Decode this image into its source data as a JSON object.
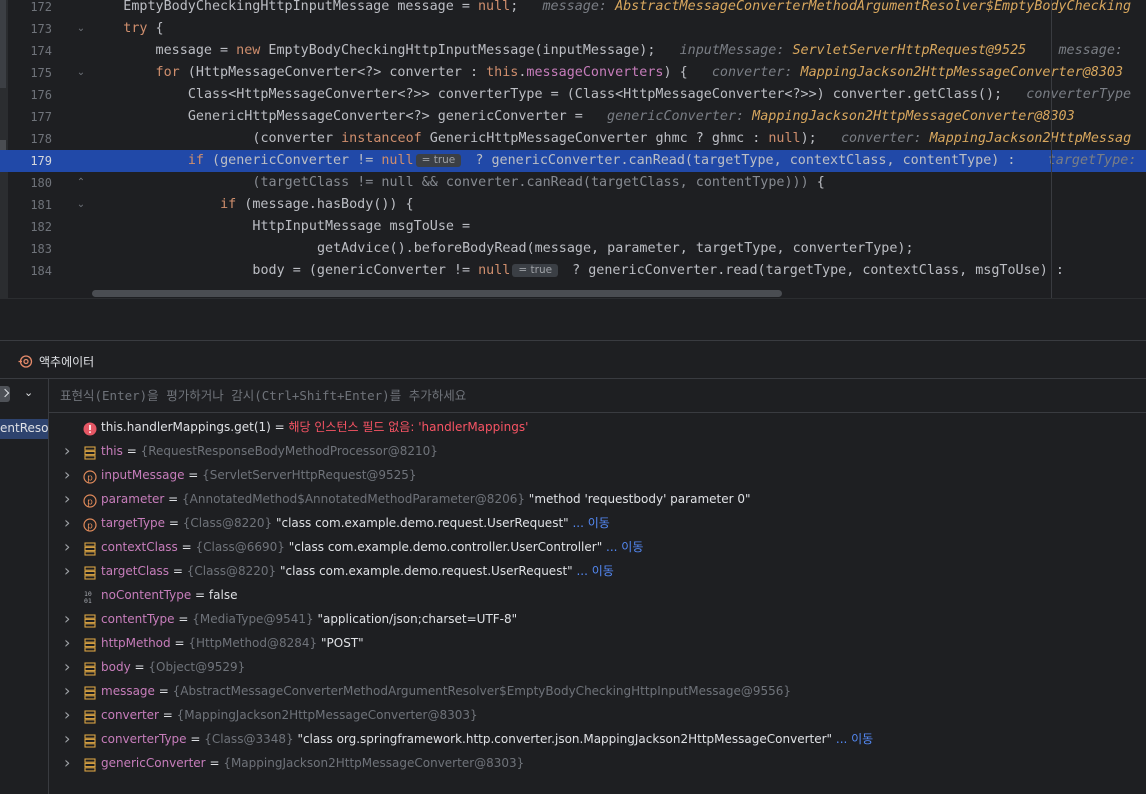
{
  "editor": {
    "lines": [
      {
        "n": "172",
        "fold": "",
        "hl": false,
        "indent": 4,
        "segs": [
          [
            "t",
            "EmptyBodyCheckingHttpInputMessage message = "
          ],
          [
            "kw",
            "null"
          ],
          [
            "t",
            ";"
          ]
        ],
        "hint": [
          [
            "n",
            "message: "
          ],
          [
            "v",
            "AbstractMessageConverterMethodArgumentResolver$EmptyBodyChecking"
          ]
        ]
      },
      {
        "n": "173",
        "fold": "⌄",
        "hl": false,
        "indent": 4,
        "segs": [
          [
            "kw",
            "try"
          ],
          [
            "t",
            " {"
          ]
        ],
        "hint": []
      },
      {
        "n": "174",
        "fold": "",
        "hl": false,
        "indent": 8,
        "segs": [
          [
            "t",
            "message = "
          ],
          [
            "kw",
            "new"
          ],
          [
            "t",
            " EmptyBodyCheckingHttpInputMessage(inputMessage);"
          ]
        ],
        "hint": [
          [
            "n",
            "inputMessage: "
          ],
          [
            "v",
            "ServletServerHttpRequest@9525"
          ],
          [
            "n",
            "    message: "
          ]
        ]
      },
      {
        "n": "175",
        "fold": "⌄",
        "hl": false,
        "indent": 8,
        "segs": [
          [
            "kw",
            "for"
          ],
          [
            "t",
            " (HttpMessageConverter<?> converter : "
          ],
          [
            "kw",
            "this"
          ],
          [
            "t",
            "."
          ],
          [
            "fld",
            "messageConverters"
          ],
          [
            "t",
            ") {"
          ]
        ],
        "hint": [
          [
            "n",
            "converter: "
          ],
          [
            "v",
            "MappingJackson2HttpMessageConverter@8303"
          ]
        ]
      },
      {
        "n": "176",
        "fold": "",
        "hl": false,
        "indent": 12,
        "segs": [
          [
            "t",
            "Class<HttpMessageConverter<?>> converterType = (Class<HttpMessageConverter<?>>) converter.getClass();"
          ]
        ],
        "hint": [
          [
            "n",
            "converterType"
          ]
        ]
      },
      {
        "n": "177",
        "fold": "",
        "hl": false,
        "indent": 12,
        "segs": [
          [
            "t",
            "GenericHttpMessageConverter<?> genericConverter ="
          ]
        ],
        "hint": [
          [
            "n",
            "genericConverter: "
          ],
          [
            "v",
            "MappingJackson2HttpMessageConverter@8303"
          ]
        ]
      },
      {
        "n": "178",
        "fold": "",
        "hl": false,
        "indent": 20,
        "segs": [
          [
            "t",
            "(converter "
          ],
          [
            "kw",
            "instanceof"
          ],
          [
            "t",
            " GenericHttpMessageConverter ghmc ? ghmc : "
          ],
          [
            "kw",
            "null"
          ],
          [
            "t",
            ");"
          ]
        ],
        "hint": [
          [
            "n",
            "converter: "
          ],
          [
            "v",
            "MappingJackson2HttpMessag"
          ]
        ]
      },
      {
        "n": "179",
        "fold": "",
        "hl": true,
        "indent": 12,
        "segs": [
          [
            "kw",
            "if"
          ],
          [
            "t",
            " (genericConverter != "
          ],
          [
            "kw",
            "null"
          ],
          [
            "chip",
            "= true"
          ],
          [
            "t",
            " ? genericConverter.canRead(targetType, contextClass, contentType) : "
          ]
        ],
        "hint": [
          [
            "n",
            "targetType: "
          ]
        ]
      },
      {
        "n": "180",
        "fold": "⌃",
        "hl": false,
        "indent": 20,
        "segs": [
          [
            "gry",
            "(targetClass != null && converter.canRead(targetClass, contentType)))"
          ],
          [
            "t",
            " {"
          ]
        ],
        "hint": []
      },
      {
        "n": "181",
        "fold": "⌄",
        "hl": false,
        "indent": 16,
        "segs": [
          [
            "kw",
            "if"
          ],
          [
            "t",
            " (message.hasBody()) {"
          ]
        ],
        "hint": []
      },
      {
        "n": "182",
        "fold": "",
        "hl": false,
        "indent": 20,
        "segs": [
          [
            "t",
            "HttpInputMessage msgToUse ="
          ]
        ],
        "hint": []
      },
      {
        "n": "183",
        "fold": "",
        "hl": false,
        "indent": 28,
        "segs": [
          [
            "t",
            "getAdvice().beforeBodyRead(message, parameter, targetType, converterType);"
          ]
        ],
        "hint": []
      },
      {
        "n": "184",
        "fold": "",
        "hl": false,
        "indent": 20,
        "segs": [
          [
            "t",
            "body = (genericConverter != "
          ],
          [
            "kw",
            "null"
          ],
          [
            "chip",
            "= true"
          ],
          [
            "t",
            " ? genericConverter.read(targetType, contextClass, msgToUse) :"
          ]
        ],
        "hint": []
      }
    ]
  },
  "debugger": {
    "tab_label": "액추에이터",
    "frame_label": "entResolv",
    "expr_placeholder": "표현식(Enter)을 평가하거나 감시(Ctrl+Shift+Enter)를 추가하세요",
    "variables": [
      {
        "icon": "error",
        "expand": false,
        "name": "this.handlerMappings.get(1)",
        "eq": " = ",
        "ref": "",
        "value": "해당 인스턴스 필드 없음: 'handlerMappings'",
        "link": "",
        "style": "error"
      },
      {
        "icon": "field",
        "expand": true,
        "name": "this",
        "eq": " = ",
        "ref": "{RequestResponseBodyMethodProcessor@8210}",
        "value": "",
        "link": "",
        "style": "field"
      },
      {
        "icon": "param",
        "expand": true,
        "name": "inputMessage",
        "eq": " = ",
        "ref": "{ServletServerHttpRequest@9525}",
        "value": "",
        "link": "",
        "style": "field"
      },
      {
        "icon": "param",
        "expand": true,
        "name": "parameter",
        "eq": " = ",
        "ref": "{AnnotatedMethod$AnnotatedMethodParameter@8206}",
        "value": " \"method 'requestbody' parameter 0\"",
        "link": "",
        "style": "field"
      },
      {
        "icon": "param",
        "expand": true,
        "name": "targetType",
        "eq": " = ",
        "ref": "{Class@8220}",
        "value": " \"class com.example.demo.request.UserRequest\"",
        "link": " ... 이동",
        "style": "field"
      },
      {
        "icon": "field",
        "expand": true,
        "name": "contextClass",
        "eq": " = ",
        "ref": "{Class@6690}",
        "value": " \"class com.example.demo.controller.UserController\"",
        "link": " ... 이동",
        "style": "field"
      },
      {
        "icon": "field",
        "expand": true,
        "name": "targetClass",
        "eq": " = ",
        "ref": "{Class@8220}",
        "value": " \"class com.example.demo.request.UserRequest\"",
        "link": " ... 이동",
        "style": "field"
      },
      {
        "icon": "prim",
        "expand": false,
        "name": "noContentType",
        "eq": " = ",
        "ref": "",
        "value": "false",
        "link": "",
        "style": "plain"
      },
      {
        "icon": "field",
        "expand": true,
        "name": "contentType",
        "eq": " = ",
        "ref": "{MediaType@9541}",
        "value": " \"application/json;charset=UTF-8\"",
        "link": "",
        "style": "field"
      },
      {
        "icon": "field",
        "expand": true,
        "name": "httpMethod",
        "eq": " = ",
        "ref": "{HttpMethod@8284}",
        "value": " \"POST\"",
        "link": "",
        "style": "field"
      },
      {
        "icon": "field",
        "expand": true,
        "name": "body",
        "eq": " = ",
        "ref": "{Object@9529}",
        "value": "",
        "link": "",
        "style": "field"
      },
      {
        "icon": "field",
        "expand": true,
        "name": "message",
        "eq": " = ",
        "ref": "{AbstractMessageConverterMethodArgumentResolver$EmptyBodyCheckingHttpInputMessage@9556}",
        "value": "",
        "link": "",
        "style": "field"
      },
      {
        "icon": "field",
        "expand": true,
        "name": "converter",
        "eq": " = ",
        "ref": "{MappingJackson2HttpMessageConverter@8303}",
        "value": "",
        "link": "",
        "style": "field"
      },
      {
        "icon": "field",
        "expand": true,
        "name": "converterType",
        "eq": " = ",
        "ref": "{Class@3348}",
        "value": " \"class org.springframework.http.converter.json.MappingJackson2HttpMessageConverter\"",
        "link": " ... 이동",
        "style": "field"
      },
      {
        "icon": "field",
        "expand": true,
        "name": "genericConverter",
        "eq": " = ",
        "ref": "{MappingJackson2HttpMessageConverter@8303}",
        "value": "",
        "link": "",
        "style": "field"
      }
    ]
  }
}
